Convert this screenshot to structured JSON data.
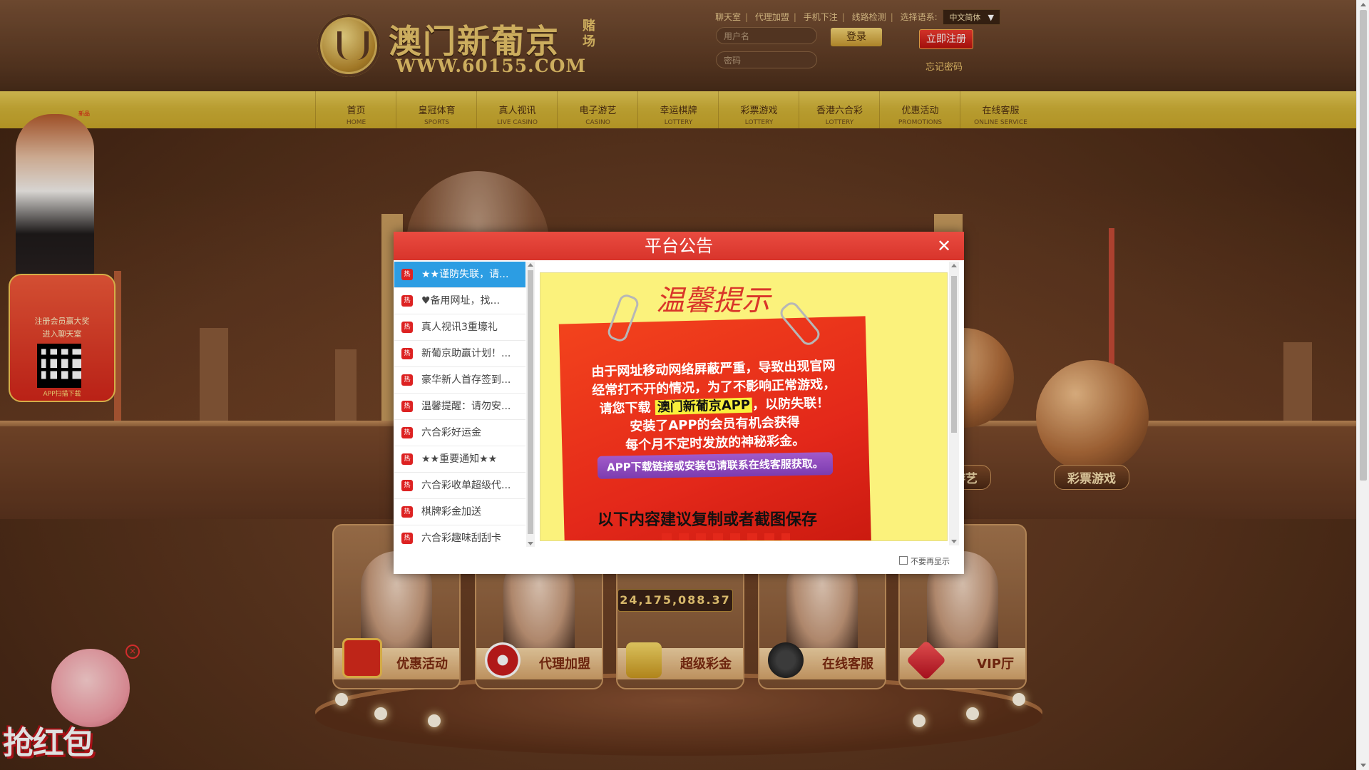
{
  "header": {
    "logo_title": "澳门新葡京",
    "logo_sub": "赌场",
    "logo_url": "WWW.60155.COM",
    "top_links": [
      "聊天室",
      "代理加盟",
      "手机下注",
      "线路检测"
    ],
    "lang_label": "选择语系:",
    "lang_value": "中文简体",
    "username_placeholder": "用户名",
    "password_placeholder": "密码",
    "login_label": "登录",
    "register_label": "立即注册",
    "forgot_label": "忘记密码"
  },
  "nav": {
    "items": [
      {
        "cn": "首页",
        "en": "HOME"
      },
      {
        "cn": "皇冠体育",
        "en": "SPORTS"
      },
      {
        "cn": "真人视讯",
        "en": "LIVE CASINO"
      },
      {
        "cn": "电子游艺",
        "en": "CASINO"
      },
      {
        "cn": "幸运棋牌",
        "en": "LOTTERY"
      },
      {
        "cn": "彩票游戏",
        "en": "LOTTERY"
      },
      {
        "cn": "香港六合彩",
        "en": "LOTTERY"
      },
      {
        "cn": "优惠活动",
        "en": "PROMOTIONS"
      },
      {
        "cn": "在线客服",
        "en": "ONLINE SERVICE"
      }
    ],
    "new_badge": "新品"
  },
  "scene": {
    "sphere_labels": [
      "游艺",
      "彩票游戏"
    ]
  },
  "cards": [
    {
      "label": "优惠活动",
      "icon": "gift-icon"
    },
    {
      "label": "代理加盟",
      "icon": "chip-icon"
    },
    {
      "label": "超级彩金",
      "icon": "gold-icon"
    },
    {
      "label": "在线客服",
      "icon": "headset-icon"
    },
    {
      "label": "VIP厅",
      "icon": "vip-gem-icon"
    }
  ],
  "jackpot_value": "24,175,088.37",
  "left_promo": {
    "line1": "注册会员赢大奖",
    "line2": "进入聊天室",
    "download": "APP扫描下载"
  },
  "hongbao_label": "抢红包",
  "modal": {
    "title": "平台公告",
    "list": [
      "★★谨防失联，请...",
      "♥备用网址，找...",
      "真人视讯3重壕礼",
      "新葡京助赢计划！...",
      "豪华新人首存签到...",
      "温馨提醒：请勿安...",
      "六合彩好运金",
      "★★重要通知★★",
      "六合彩收单超级代...",
      "棋牌彩金加送",
      "六合彩趣味刮刮卡"
    ],
    "hot_tag": "热",
    "notice": {
      "title": "温馨提示",
      "line1": "由于网址移动网络屏蔽严重，导致出现官网",
      "line2": "经常打不开的情况，为了不影响正常游戏，",
      "line3_pre": "请您下载",
      "line3_hl": "澳门新葡京APP",
      "line3_post": "，以防失联！",
      "line4": "安装了APP的会员有机会获得",
      "line5": "每个月不定时发放的神秘彩金。",
      "purple": "APP下载链接或安装包请联系在线客服获取。",
      "save_tip": "以下内容建议复制或者截图保存"
    },
    "dont_show": "不要再显示"
  }
}
